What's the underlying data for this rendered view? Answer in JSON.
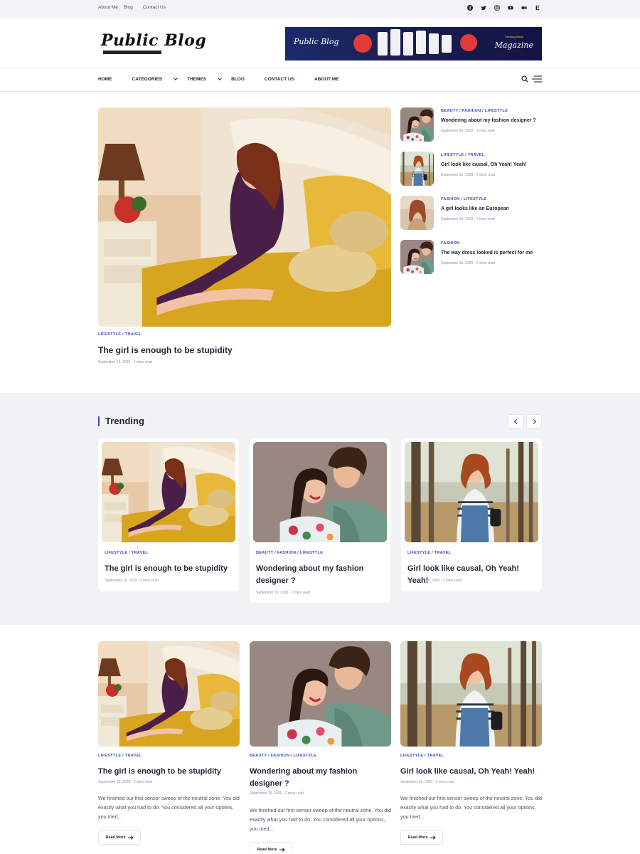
{
  "topbar": {
    "links": [
      "About Me",
      "Blog",
      "Contact Us"
    ],
    "social": [
      "facebook-icon",
      "twitter-icon",
      "instagram-icon",
      "youtube-icon",
      "medium-icon",
      "envato-icon"
    ]
  },
  "header": {
    "logo_title": "Public Blog",
    "banner": {
      "left_text": "Public Blog",
      "right_text": "Magazine",
      "small_text": "Trending News"
    }
  },
  "nav": {
    "items": [
      "HOME",
      "CATEGORIES",
      "THEMES",
      "BLOG",
      "CONTACT US",
      "ABOUT ME"
    ]
  },
  "hero": {
    "cats": "LIFESTYLE  / TRAVEL",
    "title": "The girl is enough to be stupidity",
    "meta": "September 16, 2020  ·  2 mins read"
  },
  "side": [
    {
      "cats": "BEAUTY  / FASHION  / LIFESTYLE",
      "title": "Wondering about my fashion designer ?",
      "meta": "September 16, 2020  ·  2 mins read"
    },
    {
      "cats": "LIFESTYLE  / TRAVEL",
      "title": "Girl look like causal, Oh Yeah! Yeah!",
      "meta": "September 16, 2020  ·  2 mins read"
    },
    {
      "cats": "FASHION  / LIFESTYLE",
      "title": "A girl looks like an European",
      "meta": "September 16, 2020  ·  2 mins read"
    },
    {
      "cats": "FASHION",
      "title": "The way dress looked is perfect for me",
      "meta": "September 16, 2020  ·  2 mins read"
    }
  ],
  "trending": {
    "heading": "Trending",
    "cards": [
      {
        "cats": "LIFESTYLE  / TRAVEL",
        "title": "The girl is enough to be stupidity",
        "meta": "September 16, 2020  ·  2 mins read"
      },
      {
        "cats": "BEAUTY  / FASHION  / LIFESTYLE",
        "title": "Wondering about my fashion designer ?",
        "meta": "September 16, 2020  ·  2 mins read"
      },
      {
        "cats": "LIFESTYLE  / TRAVEL",
        "title": "Girl look like causal, Oh Yeah! Yeah!",
        "meta": "September 16, 2020  ·  2 mins read"
      }
    ]
  },
  "grid": {
    "read_more": "Read More",
    "cards": [
      {
        "cats": "LIFESTYLE  / TRAVEL",
        "title": "The girl is enough to be stupidity",
        "meta": "September 16, 2020  ·  2 mins read",
        "excerpt": "We finished our first sensor sweep of the neutral zone. You did exactly what you had to do. You considered all your options, you tried..."
      },
      {
        "cats": "BEAUTY  / FASHION  / LIFESTYLE",
        "title": "Wondering about my fashion designer ?",
        "meta": "September 16, 2020  ·  2 mins read",
        "excerpt": "We finished our first sensor sweep of the neutral zone. You did exactly what you had to do. You considered all your options, you tried..."
      },
      {
        "cats": "LIFESTYLE  / TRAVEL",
        "title": "Girl look like causal, Oh Yeah! Yeah!",
        "meta": "September 16, 2020  ·  2 mins read",
        "excerpt": "We finished our first sensor sweep of the neutral zone. You did exactly what you had to do. You considered all your options, you tried..."
      }
    ]
  },
  "colors": {
    "accent": "#3b4bc8",
    "text": "#1d2433",
    "muted": "#8a90a0",
    "band": "#f1f2f4"
  }
}
